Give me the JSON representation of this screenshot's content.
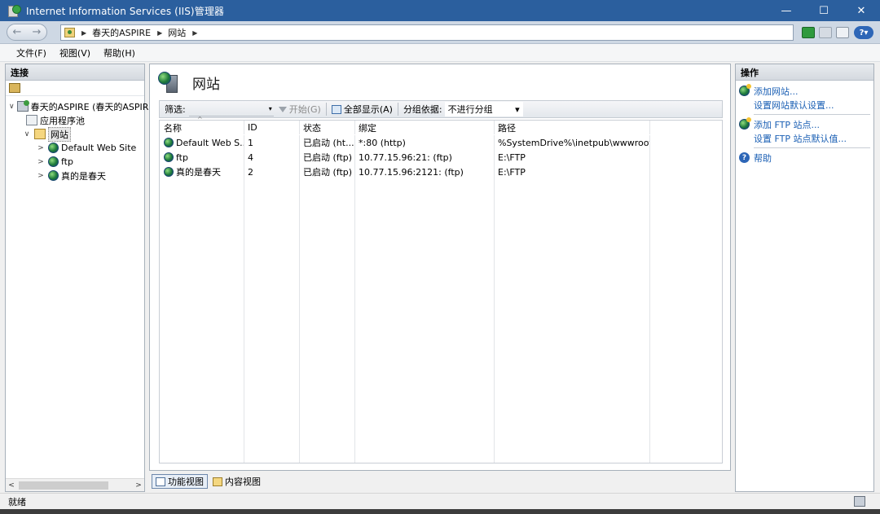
{
  "window": {
    "title": "Internet Information Services (IIS)管理器",
    "caption": {
      "minimize": "—",
      "maximize": "☐",
      "close": "✕"
    }
  },
  "address": {
    "back": "←",
    "forward": "→",
    "segments": [
      "春天的ASPIRE",
      "网站"
    ],
    "separator": "▶",
    "help_glyph": "?",
    "help_caret": "▾"
  },
  "menu": {
    "items": [
      "文件(F)",
      "视图(V)",
      "帮助(H)"
    ]
  },
  "connections": {
    "header": "连接",
    "tree": {
      "server": "春天的ASPIRE (春天的ASPIRE",
      "app_pools": "应用程序池",
      "sites": "网站",
      "site_items": [
        "Default Web Site",
        "ftp",
        "真的是春天"
      ]
    },
    "scroll_left": "<",
    "scroll_right": ">"
  },
  "main": {
    "title": "网站",
    "filter": {
      "label": "筛选:",
      "start": "开始(G)",
      "show_all": "全部显示(A)",
      "group_by_label": "分组依据:",
      "group_by_value": "不进行分组",
      "dropdown_glyph": "▾"
    },
    "table": {
      "sort_glyph": "^",
      "columns": [
        "名称",
        "ID",
        "状态",
        "绑定",
        "路径",
        ""
      ],
      "rows": [
        {
          "name": "Default Web S...",
          "id": "1",
          "status": "已启动 (ht...",
          "binding": "*:80 (http)",
          "path": "%SystemDrive%\\inetpub\\wwwroot"
        },
        {
          "name": "ftp",
          "id": "4",
          "status": "已启动 (ftp)",
          "binding": "10.77.15.96:21: (ftp)",
          "path": "E:\\FTP"
        },
        {
          "name": "真的是春天",
          "id": "2",
          "status": "已启动 (ftp)",
          "binding": "10.77.15.96:2121: (ftp)",
          "path": "E:\\FTP"
        }
      ]
    },
    "views": {
      "features": "功能视图",
      "content": "内容视图"
    }
  },
  "actions": {
    "header": "操作",
    "add_site": "添加网站...",
    "site_defaults": "设置网站默认设置...",
    "add_ftp": "添加 FTP 站点...",
    "ftp_defaults": "设置 FTP 站点默认值...",
    "help": "帮助",
    "help_glyph": "?"
  },
  "status": {
    "text": "就绪"
  }
}
